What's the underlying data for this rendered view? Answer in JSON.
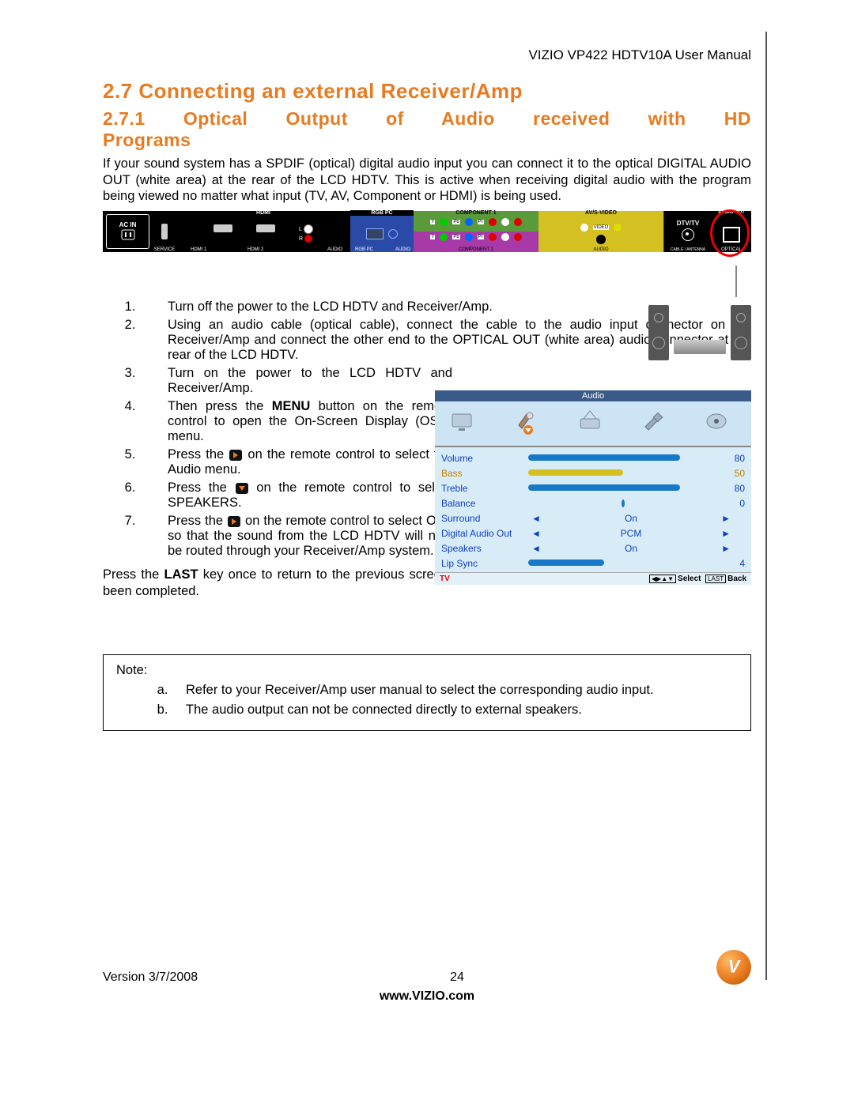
{
  "header": {
    "product": "VIZIO VP422 HDTV10A User Manual"
  },
  "headings": {
    "section": "2.7  Connecting an external Receiver/Amp",
    "subsection_l1": "2.7.1 Optical  Output  of  Audio  received  with  HD",
    "subsection_l2": "Programs"
  },
  "intro": "If your sound system has a SPDIF (optical) digital audio input you can connect it to the optical DIGITAL AUDIO OUT (white area) at the rear of the LCD HDTV.  This is active when receiving digital audio with the program being viewed no matter what input (TV, AV, Component or HDMI) is being used.",
  "tv_panel": {
    "acin": "AC IN",
    "service": "SERVICE",
    "hdmi": "HDMI",
    "hdmi1": "HDMI 1",
    "hdmi2": "HDMI 2",
    "audio": "AUDIO",
    "lr": "L●\nR●",
    "rgb": "RGB PC",
    "comp1": "COMPONENT 1",
    "comp2": "COMPONENT 2",
    "avs": "AV/S-VIDEO",
    "dtv": "DTV/TV",
    "cable": "CABLE / ANTENNA",
    "audio_out": "AUDIO OUT",
    "optical": "OPTICAL"
  },
  "steps": [
    "Turn off the power to the LCD HDTV and Receiver/Amp.",
    "Using an audio cable (optical cable), connect the cable to the audio input connector on the Receiver/Amp and connect the other end to the OPTICAL OUT (white area) audio connector at the rear of the LCD HDTV.",
    "Turn on the power to the LCD HDTV and Receiver/Amp.",
    "Then press the MENU button on the remote control to open the On-Screen Display (OSD) menu.",
    "Press the ▶ on the remote control to select the Audio menu.",
    "Press the ▼ on the remote control to select SPEAKERS.",
    "Press the ▶ on the remote control to select OFF so that the sound from the LCD HDTV will now be routed through your Receiver/Amp system."
  ],
  "step4_pre": "Then press the ",
  "step4_bold": "MENU",
  "step4_post": " button on the remote control to open the On-Screen Display (OSD) menu.",
  "step5_pre": "Press the ",
  "step5_post": " on the remote control to select the Audio menu.",
  "step6_pre": "Press the ",
  "step6_post": "  on the remote control to select SPEAKERS.",
  "step7_pre": "Press the ",
  "step7_post": " on the remote control to select OFF so that the sound from the LCD HDTV will now be routed through your Receiver/Amp system.",
  "last_para_pre": "Press the ",
  "last_para_bold": "LAST",
  "last_para_post": " key once to return to the previous screen or repeatedly to return to your program if task has been completed.",
  "osd": {
    "title": "Audio",
    "rows": [
      {
        "label": "Volume",
        "bar": 80,
        "value": "80",
        "color": "blue"
      },
      {
        "label": "Bass",
        "bar": 50,
        "value": "50",
        "color": "yellow",
        "label_color": "#c08000"
      },
      {
        "label": "Treble",
        "bar": 80,
        "value": "80",
        "color": "blue"
      },
      {
        "label": "Balance",
        "bar": 0,
        "value": "0",
        "color": "blue",
        "center_dot": true
      },
      {
        "label": "Surround",
        "center": "On"
      },
      {
        "label": "Digital Audio Out",
        "center": "PCM"
      },
      {
        "label": "Speakers",
        "center": "On"
      },
      {
        "label": "Lip Sync",
        "bar": 40,
        "value": "4",
        "color": "blue"
      }
    ],
    "foot_left": "TV",
    "foot_select_key": "◀▶▲▼",
    "foot_select": "Select",
    "foot_back_key": "LAST",
    "foot_back": "Back"
  },
  "note": {
    "title": "Note:",
    "a": "Refer to your Receiver/Amp user manual to select the corresponding audio input.",
    "b": "The audio output can not be connected directly to external speakers."
  },
  "footer": {
    "version": "Version 3/7/2008",
    "page": "24",
    "url": "www.VIZIO.com"
  }
}
